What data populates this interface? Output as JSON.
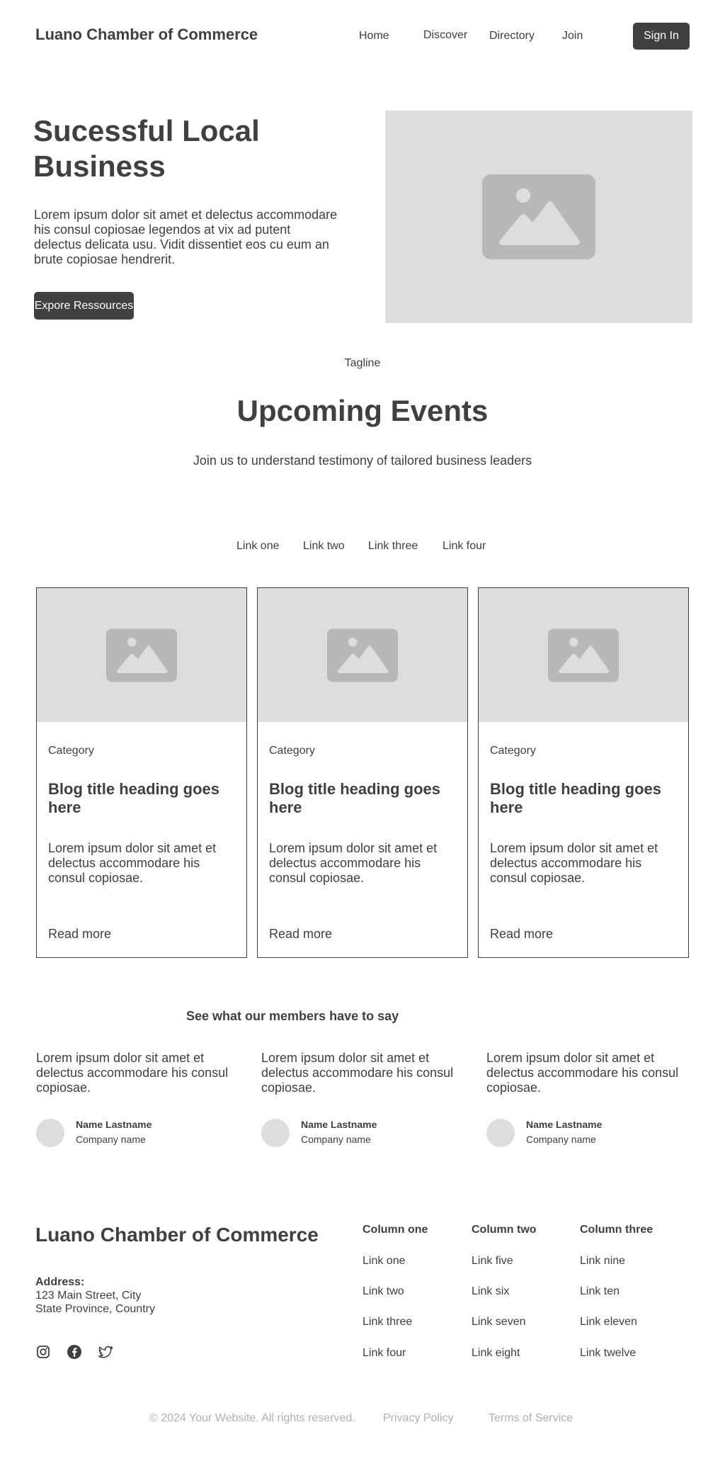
{
  "header": {
    "brand": "Luano Chamber of Commerce",
    "nav": [
      "Home",
      "Discover",
      "Directory",
      "Join"
    ],
    "sign_in": "Sign In"
  },
  "hero": {
    "title": "Sucessful Local Business",
    "body": "Lorem ipsum dolor sit amet et delectus accommodare his consul copiosae legendos at vix ad putent delectus delicata usu. Vidit dissentiet eos cu eum an brute copiosae hendrerit.",
    "button": "Expore Ressources",
    "image_icon": "image-placeholder-icon"
  },
  "events": {
    "tagline": "Tagline",
    "title": "Upcoming Events",
    "subtitle": "Join us to understand testimony of tailored business leaders",
    "tabs": [
      "Link one",
      "Link two",
      "Link three",
      "Link four"
    ]
  },
  "cards": [
    {
      "category": "Category",
      "title": "Blog title heading goes here",
      "body": "Lorem ipsum dolor sit amet et delectus accommodare his consul copiosae.",
      "read_more": "Read more"
    },
    {
      "category": "Category",
      "title": "Blog title heading goes here",
      "body": "Lorem ipsum dolor sit amet et delectus accommodare his consul copiosae.",
      "read_more": "Read more"
    },
    {
      "category": "Category",
      "title": "Blog title heading goes here",
      "body": "Lorem ipsum dolor sit amet et delectus accommodare his consul copiosae.",
      "read_more": "Read more"
    }
  ],
  "testimonials": {
    "heading": "See what our members have to say",
    "items": [
      {
        "quote": "Lorem ipsum dolor sit amet et delectus accommodare his consul copiosae.",
        "name": "Name Lastname",
        "company": "Company name"
      },
      {
        "quote": "Lorem ipsum dolor sit amet et delectus accommodare his consul copiosae.",
        "name": "Name Lastname",
        "company": "Company name"
      },
      {
        "quote": "Lorem ipsum dolor sit amet et delectus accommodare his consul copiosae.",
        "name": "Name Lastname",
        "company": "Company name"
      }
    ]
  },
  "footer": {
    "brand": "Luano Chamber of Commerce",
    "address_label": "Address:",
    "address_lines": [
      "123 Main Street, City",
      "State Province, Country"
    ],
    "social_icons": [
      "instagram-icon",
      "facebook-icon",
      "twitter-icon"
    ],
    "columns": [
      {
        "heading": "Column one",
        "links": [
          "Link one",
          "Link two",
          "Link three",
          "Link four"
        ]
      },
      {
        "heading": "Column two",
        "links": [
          "Link five",
          "Link six",
          "Link seven",
          "Link eight"
        ]
      },
      {
        "heading": "Column three",
        "links": [
          "Link nine",
          "Link ten",
          "Link eleven",
          "Link twelve"
        ]
      }
    ],
    "copyright": "© 2024 Your Website. All rights reserved.",
    "privacy": "Privacy Policy",
    "terms": "Terms of Service"
  },
  "colors": {
    "primary": "#404040",
    "placeholder_bg": "#dddddd",
    "placeholder_icon": "#b8b8b8",
    "muted_text": "#b0b0b0"
  }
}
